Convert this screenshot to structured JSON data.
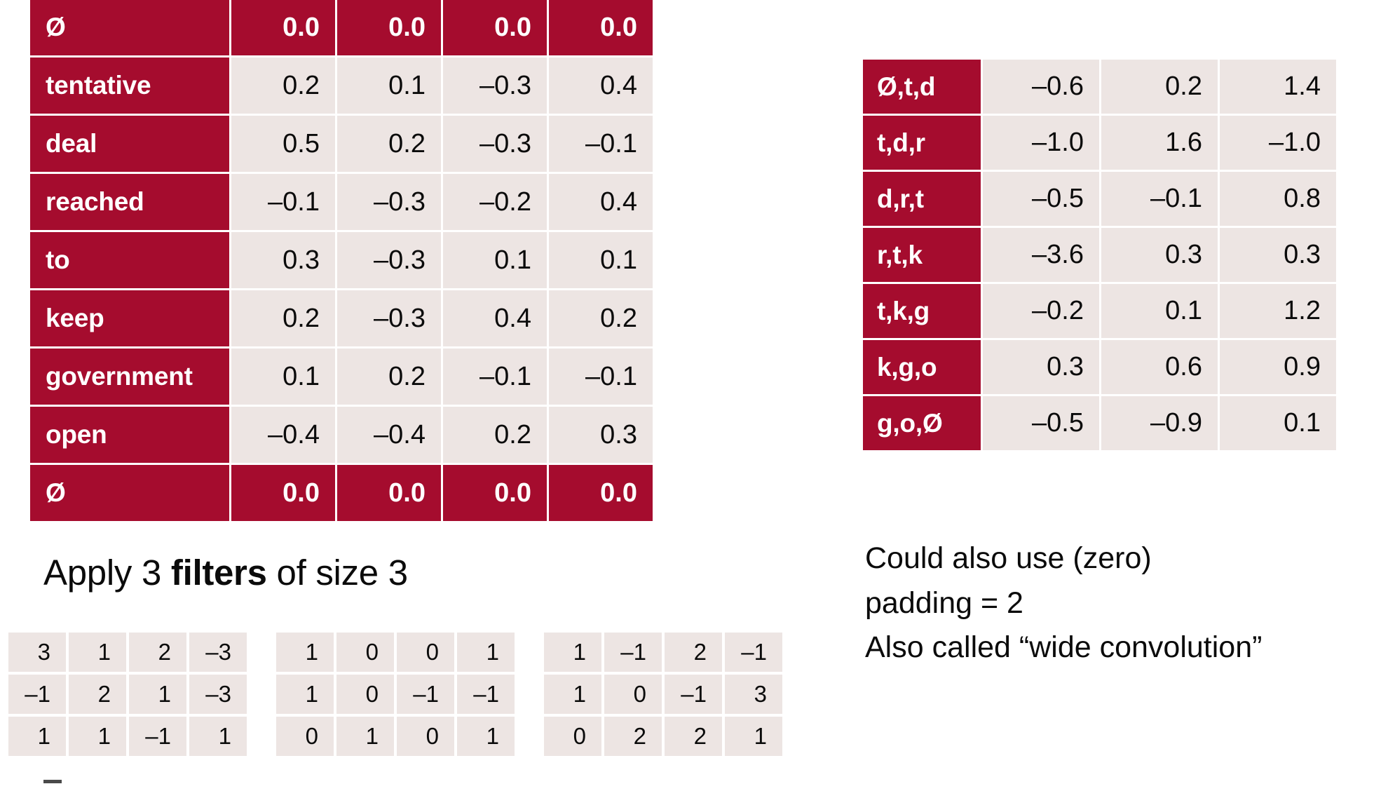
{
  "colors": {
    "accent_red": "#A50C2E",
    "cell_bg": "#EDE5E3",
    "text": "#0B0B0B",
    "label_text": "#FFFFFF",
    "page_bg": "#FFFFFF"
  },
  "embedding_table": {
    "name": "sentence-word-embeddings",
    "rows": [
      {
        "label": "Ø",
        "padding": true,
        "values": [
          "0.0",
          "0.0",
          "0.0",
          "0.0"
        ]
      },
      {
        "label": "tentative",
        "padding": false,
        "values": [
          "0.2",
          "0.1",
          "–0.3",
          "0.4"
        ]
      },
      {
        "label": "deal",
        "padding": false,
        "values": [
          "0.5",
          "0.2",
          "–0.3",
          "–0.1"
        ]
      },
      {
        "label": "reached",
        "padding": false,
        "values": [
          "–0.1",
          "–0.3",
          "–0.2",
          "0.4"
        ]
      },
      {
        "label": "to",
        "padding": false,
        "values": [
          "0.3",
          "–0.3",
          "0.1",
          "0.1"
        ]
      },
      {
        "label": "keep",
        "padding": false,
        "values": [
          "0.2",
          "–0.3",
          "0.4",
          "0.2"
        ]
      },
      {
        "label": "government",
        "padding": false,
        "values": [
          "0.1",
          "0.2",
          "–0.1",
          "–0.1"
        ]
      },
      {
        "label": "open",
        "padding": false,
        "values": [
          "–0.4",
          "–0.4",
          "0.2",
          "0.3"
        ]
      },
      {
        "label": "Ø",
        "padding": true,
        "values": [
          "0.0",
          "0.0",
          "0.0",
          "0.0"
        ]
      }
    ]
  },
  "trigram_table": {
    "name": "convolution-output-feature-map",
    "rows": [
      {
        "label": "Ø,t,d",
        "values": [
          "–0.6",
          "0.2",
          "1.4"
        ]
      },
      {
        "label": "t,d,r",
        "values": [
          "–1.0",
          "1.6",
          "–1.0"
        ]
      },
      {
        "label": "d,r,t",
        "values": [
          "–0.5",
          "–0.1",
          "0.8"
        ]
      },
      {
        "label": "r,t,k",
        "values": [
          "–3.6",
          "0.3",
          "0.3"
        ]
      },
      {
        "label": "t,k,g",
        "values": [
          "–0.2",
          "0.1",
          "1.2"
        ]
      },
      {
        "label": "k,g,o",
        "values": [
          "0.3",
          "0.6",
          "0.9"
        ]
      },
      {
        "label": "g,o,Ø",
        "values": [
          "–0.5",
          "–0.9",
          "0.1"
        ]
      }
    ]
  },
  "apply_heading": {
    "part1": "Apply 3 ",
    "bold": "filters",
    "part2": " of size 3"
  },
  "filters": [
    {
      "name": "filter-1",
      "rows": [
        [
          "3",
          "1",
          "2",
          "–3"
        ],
        [
          "–1",
          "2",
          "1",
          "–3"
        ],
        [
          "1",
          "1",
          "–1",
          "1"
        ]
      ]
    },
    {
      "name": "filter-2",
      "rows": [
        [
          "1",
          "0",
          "0",
          "1"
        ],
        [
          "1",
          "0",
          "–1",
          "–1"
        ],
        [
          "0",
          "1",
          "0",
          "1"
        ]
      ]
    },
    {
      "name": "filter-3",
      "rows": [
        [
          "1",
          "–1",
          "2",
          "–1"
        ],
        [
          "1",
          "0",
          "–1",
          "3"
        ],
        [
          "0",
          "2",
          "2",
          "1"
        ]
      ]
    }
  ],
  "notes": {
    "line1": "Could also use (zero)",
    "line2": "padding = 2",
    "line3": "Also called “wide convolution”"
  }
}
